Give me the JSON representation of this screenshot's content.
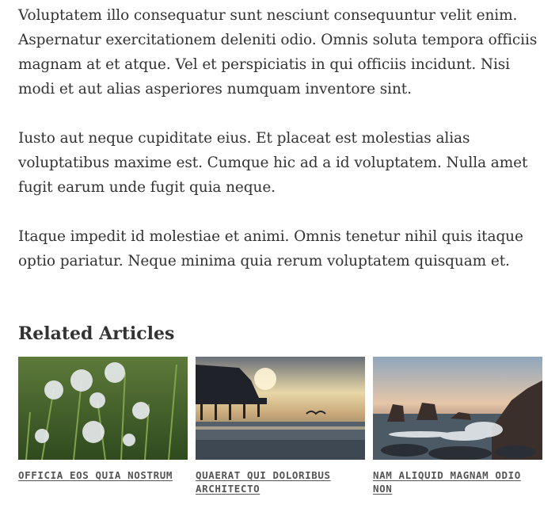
{
  "body": {
    "paragraphs": [
      "Voluptatem illo consequatur sunt nesciunt consequuntur velit enim. Aspernatur exercitationem deleniti odio. Omnis soluta tempora officiis magnam at et atque. Vel et perspiciatis in qui officiis incidunt. Nisi modi et aut alias asperiores numquam inventore sint.",
      "Iusto aut neque cupiditate eius. Et placeat est molestias alias voluptatibus maxime est. Cumque hic ad a id voluptatem. Nulla amet fugit earum unde fugit quia neque.",
      "Itaque impedit id molestiae et animi. Omnis tenetur nihil quis itaque optio pariatur. Neque minima quia rerum voluptatem quisquam et."
    ]
  },
  "related": {
    "heading": "Related Articles",
    "articles": [
      {
        "title": "OFFICIA EOS QUIA NOSTRUM",
        "image": "dandelions-photo"
      },
      {
        "title": "QUAERAT QUI DOLORIBUS ARCHITECTO",
        "image": "pier-sunset-photo"
      },
      {
        "title": "NAM ALIQUID MAGNAM ODIO NON",
        "image": "rocky-coast-photo"
      }
    ]
  }
}
